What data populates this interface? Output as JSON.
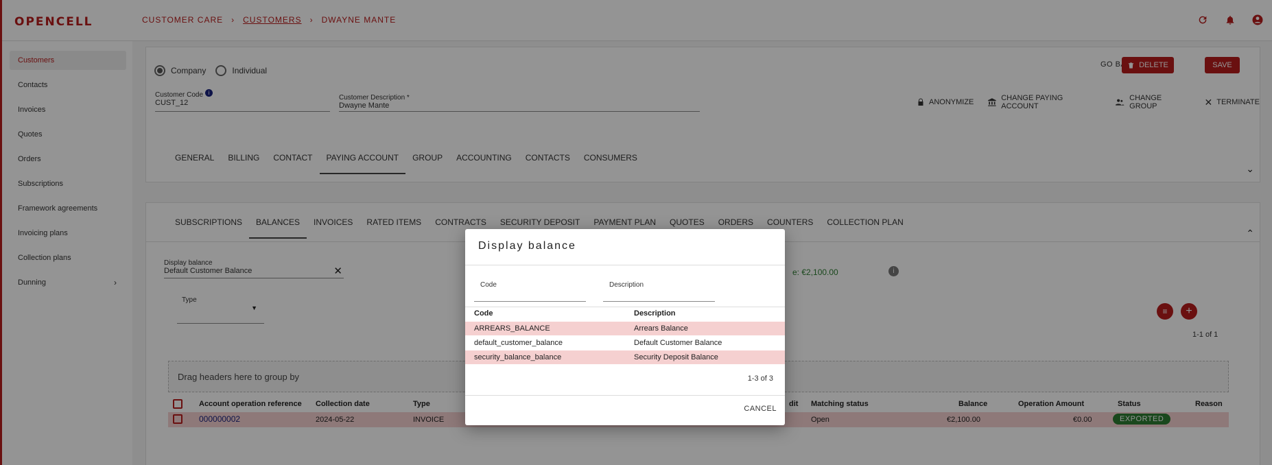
{
  "brand": "OPENCELL",
  "breadcrumb": [
    "CUSTOMER CARE",
    "CUSTOMERS",
    "DWAYNE MANTE"
  ],
  "sidebar": {
    "items": [
      {
        "label": "Customers"
      },
      {
        "label": "Contacts"
      },
      {
        "label": "Invoices"
      },
      {
        "label": "Quotes"
      },
      {
        "label": "Orders"
      },
      {
        "label": "Subscriptions"
      },
      {
        "label": "Framework agreements"
      },
      {
        "label": "Invoicing plans"
      },
      {
        "label": "Collection plans"
      },
      {
        "label": "Dunning"
      }
    ]
  },
  "form": {
    "radio_company": "Company",
    "radio_individual": "Individual",
    "code_label": "Customer Code",
    "code_value": "CUST_12",
    "desc_label": "Customer Description *",
    "desc_value": "Dwayne Mante",
    "go_back": "GO BACK",
    "delete": "DELETE",
    "save": "SAVE",
    "anonymize": "ANONYMIZE",
    "change_paying_account": "CHANGE PAYING ACCOUNT",
    "change_group": "CHANGE GROUP",
    "terminate": "TERMINATE"
  },
  "tabs1": [
    "GENERAL",
    "BILLING",
    "CONTACT",
    "PAYING ACCOUNT",
    "GROUP",
    "ACCOUNTING",
    "CONTACTS",
    "CONSUMERS"
  ],
  "tabs2": [
    "SUBSCRIPTIONS",
    "BALANCES",
    "INVOICES",
    "RATED ITEMS",
    "CONTRACTS",
    "SECURITY DEPOSIT",
    "PAYMENT PLAN",
    "QUOTES",
    "ORDERS",
    "COUNTERS",
    "COLLECTION PLAN"
  ],
  "balances": {
    "display_label": "Display balance",
    "display_value": "Default Customer Balance",
    "balance_partial": "e: €2,100.00",
    "type_label": "Type",
    "pager": "1-1 of 1",
    "group_hint": "Drag headers here to group by",
    "columns": {
      "ref": "Account operation reference",
      "date": "Collection date",
      "type": "Type",
      "credit_partial": "dit",
      "matching": "Matching status",
      "balance": "Balance",
      "amount": "Operation Amount",
      "status": "Status",
      "reason": "Reason"
    },
    "row": {
      "ref": "000000002",
      "date": "2024-05-22",
      "type": "INVOICE",
      "matching": "Open",
      "balance": "€2,100.00",
      "amount": "€0.00",
      "status": "EXPORTED"
    }
  },
  "dialog": {
    "title": "Display balance",
    "filter_code": "Code",
    "filter_desc": "Description",
    "col_code": "Code",
    "col_desc": "Description",
    "rows": [
      {
        "code": "ARREARS_BALANCE",
        "desc": "Arrears Balance"
      },
      {
        "code": "default_customer_balance",
        "desc": "Default Customer Balance"
      },
      {
        "code": "security_balance_balance",
        "desc": "Security Deposit Balance"
      }
    ],
    "pager": "1-3 of 3",
    "cancel": "CANCEL"
  },
  "colors": {
    "accent": "#b71c1c",
    "success": "#2e7d32",
    "row_highlight": "#f5d0d0"
  }
}
